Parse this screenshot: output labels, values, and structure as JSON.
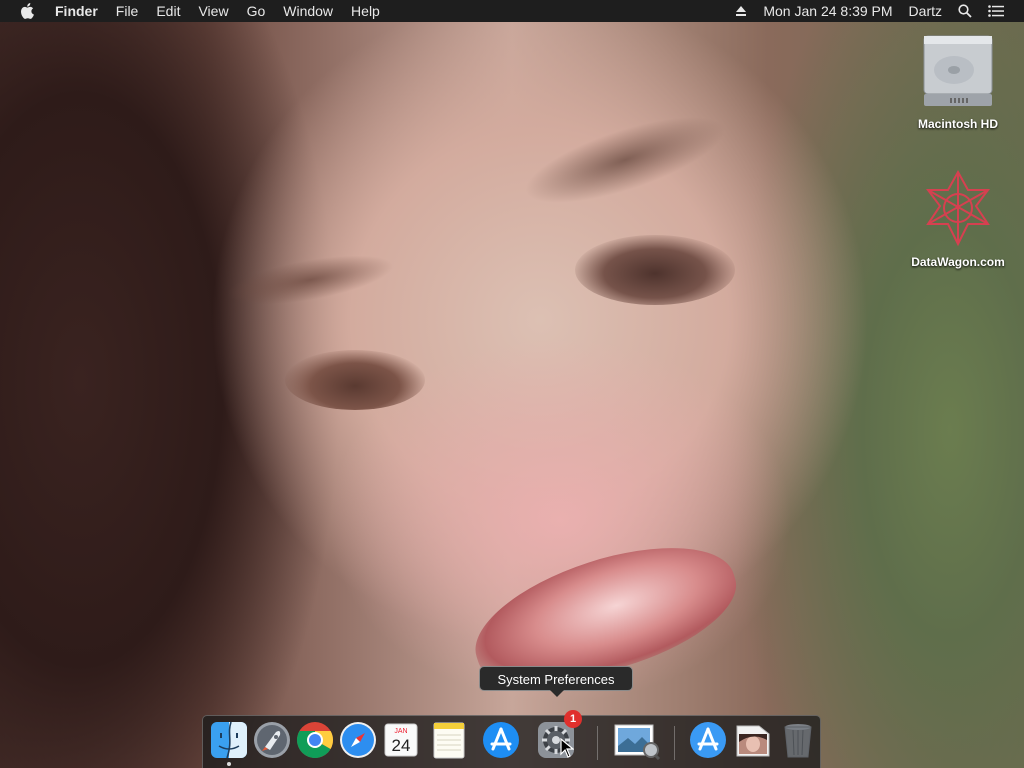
{
  "menubar": {
    "app_name": "Finder",
    "menus": [
      "File",
      "Edit",
      "View",
      "Go",
      "Window",
      "Help"
    ],
    "clock": "Mon Jan 24  8:39 PM",
    "user": "Dartz"
  },
  "desktop": {
    "icons": [
      {
        "label": "Macintosh HD",
        "icon": "hard-drive-icon"
      },
      {
        "label": "DataWagon.com",
        "icon": "network-server-icon"
      }
    ]
  },
  "tooltip": {
    "text": "System Preferences"
  },
  "dock": {
    "apps": [
      {
        "name": "Finder",
        "icon": "finder-icon",
        "running": true
      },
      {
        "name": "Launchpad",
        "icon": "launchpad-icon"
      },
      {
        "name": "Google Chrome",
        "icon": "chrome-icon"
      },
      {
        "name": "Safari",
        "icon": "safari-icon"
      },
      {
        "name": "Calendar",
        "icon": "calendar-icon",
        "month": "JAN",
        "day": "24"
      },
      {
        "name": "Notes",
        "icon": "notes-icon"
      },
      {
        "name": "App Store",
        "icon": "app-store-icon"
      },
      {
        "name": "System Preferences",
        "icon": "system-preferences-icon",
        "badge": "1"
      },
      {
        "name": "Preview",
        "icon": "preview-icon"
      },
      {
        "name": "Applications",
        "icon": "applications-folder-icon"
      },
      {
        "name": "Photo",
        "icon": "photo-thumbnail-icon"
      },
      {
        "name": "Trash",
        "icon": "trash-icon"
      }
    ]
  },
  "colors": {
    "menubar_bg": "#1e1e1e",
    "badge": "#e0302d",
    "tooltip_bg": "#2a2a2a"
  }
}
